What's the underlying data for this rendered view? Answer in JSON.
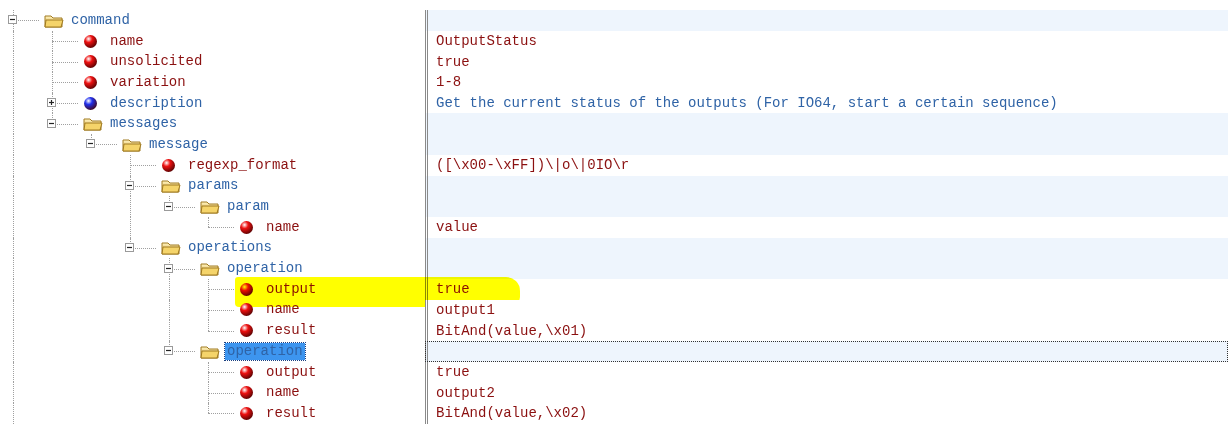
{
  "tree": [
    {
      "name": "command",
      "kind": "element",
      "expanded": true,
      "selected": false,
      "highlighted": false,
      "children": [
        {
          "name": "name",
          "kind": "attribute",
          "value": "OutputStatus",
          "selected": false,
          "highlighted": false
        },
        {
          "name": "unsolicited",
          "kind": "attribute",
          "value": "true",
          "selected": false,
          "highlighted": false
        },
        {
          "name": "variation",
          "kind": "attribute",
          "value": "1-8",
          "selected": false,
          "highlighted": false
        },
        {
          "name": "description",
          "kind": "text",
          "expanded": false,
          "value": "Get the current status of the outputs (For IO64, start a certain sequence)",
          "selected": false,
          "highlighted": false
        },
        {
          "name": "messages",
          "kind": "element",
          "expanded": true,
          "selected": false,
          "highlighted": false,
          "children": [
            {
              "name": "message",
              "kind": "element",
              "expanded": true,
              "selected": false,
              "highlighted": false,
              "children": [
                {
                  "name": "regexp_format",
                  "kind": "attribute",
                  "value": "([\\x00-\\xFF])\\|o\\|0IO\\r",
                  "selected": false,
                  "highlighted": false
                },
                {
                  "name": "params",
                  "kind": "element",
                  "expanded": true,
                  "selected": false,
                  "highlighted": false,
                  "children": [
                    {
                      "name": "param",
                      "kind": "element",
                      "expanded": true,
                      "selected": false,
                      "highlighted": false,
                      "children": [
                        {
                          "name": "name",
                          "kind": "attribute",
                          "value": "value",
                          "selected": false,
                          "highlighted": false
                        }
                      ]
                    }
                  ]
                },
                {
                  "name": "operations",
                  "kind": "element",
                  "expanded": true,
                  "selected": false,
                  "highlighted": false,
                  "children": [
                    {
                      "name": "operation",
                      "kind": "element",
                      "expanded": true,
                      "selected": false,
                      "highlighted": false,
                      "children": [
                        {
                          "name": "output",
                          "kind": "attribute",
                          "value": "true",
                          "selected": false,
                          "highlighted": true
                        },
                        {
                          "name": "name",
                          "kind": "attribute",
                          "value": "output1",
                          "selected": false,
                          "highlighted": false
                        },
                        {
                          "name": "result",
                          "kind": "attribute",
                          "value": "BitAnd(value,\\x01)",
                          "selected": false,
                          "highlighted": false
                        }
                      ]
                    },
                    {
                      "name": "operation",
                      "kind": "element",
                      "expanded": true,
                      "selected": true,
                      "highlighted": false,
                      "children": [
                        {
                          "name": "output",
                          "kind": "attribute",
                          "value": "true",
                          "selected": false,
                          "highlighted": false
                        },
                        {
                          "name": "name",
                          "kind": "attribute",
                          "value": "output2",
                          "selected": false,
                          "highlighted": false
                        },
                        {
                          "name": "result",
                          "kind": "attribute",
                          "value": "BitAnd(value,\\x02)",
                          "selected": false,
                          "highlighted": false
                        }
                      ]
                    }
                  ]
                }
              ]
            }
          ]
        }
      ]
    }
  ]
}
